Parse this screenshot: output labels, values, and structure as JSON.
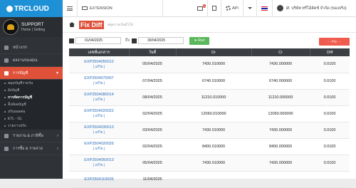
{
  "app": {
    "logo": "TRCLOUD"
  },
  "profile": {
    "name": "SUPPORT",
    "home": "Home",
    "setting": "Setting"
  },
  "sidebar": {
    "items": [
      {
        "label": "หน้าแรก"
      },
      {
        "label": "ผลงานของคุณ"
      },
      {
        "label": "การบัญชี"
      }
    ],
    "sub_items": [
      {
        "label": "สมุดบัญชีรายวัน"
      },
      {
        "label": "ผังบัญชี"
      },
      {
        "label": "การจัดการบัญชี"
      },
      {
        "label": "ลิ้งค์ผลบัญชี"
      },
      {
        "label": "ปรับยอดต่อ"
      },
      {
        "label": "ETL - GL"
      },
      {
        "label": "รายการปรับ"
      }
    ],
    "bottom_items": [
      {
        "label": "รายงาน & ภาษีซื้อ"
      },
      {
        "label": "การซื้อ & รายจ่าย"
      }
    ]
  },
  "topbar": {
    "extension": "EXTENSION",
    "mail_badge": "1",
    "api": "API",
    "user": "Ø. บริษัท ทรีโอ้ลัคช์ จำกัด (ของจริง)"
  },
  "page": {
    "title": "Fix Diff",
    "subtitle": "สมุดรายวันทั่วไป"
  },
  "filter": {
    "date_from": "01/04/2025",
    "to_label": "ถึง",
    "date_to": "30/04/2025",
    "run_label": "Run",
    "fix_label": "- - Fix - -"
  },
  "table": {
    "headers": [
      "เลขที่เอกสาร",
      "วันที่",
      "Dr",
      "Cr",
      "Diff"
    ],
    "edit_label": "[ แก้ไข ]",
    "rows": [
      {
        "doc": "EXP2504050012",
        "date": "05/04/2025",
        "dr": "7430.010000",
        "cr": "7430.000000",
        "diff": "0.0100"
      },
      {
        "doc": "EXP2504070007",
        "date": "07/04/2025",
        "dr": "6740.010000",
        "cr": "6740.000000",
        "diff": "0.0100"
      },
      {
        "doc": "EXP2504080014",
        "date": "08/04/2025",
        "dr": "11210.010000",
        "cr": "11210.000000",
        "diff": "0.0100"
      },
      {
        "doc": "EXP2504020022",
        "date": "02/04/2025",
        "dr": "12060.010000",
        "cr": "12060.000000",
        "diff": "0.0100"
      },
      {
        "doc": "EXP2504030013",
        "date": "03/04/2025",
        "dr": "7430.010000",
        "cr": "7430.000000",
        "diff": "0.0100"
      },
      {
        "doc": "EXP2504020026",
        "date": "02/04/2025",
        "dr": "8400.010000",
        "cr": "8400.000000",
        "diff": "0.0100"
      },
      {
        "doc": "EXP2504050013",
        "date": "05/04/2025",
        "dr": "7430.010000",
        "cr": "7430.000000",
        "diff": "0.0100"
      },
      {
        "doc": "EXP2504110026",
        "date": "11/04/2025",
        "dr": "",
        "cr": "",
        "diff": ""
      }
    ]
  }
}
